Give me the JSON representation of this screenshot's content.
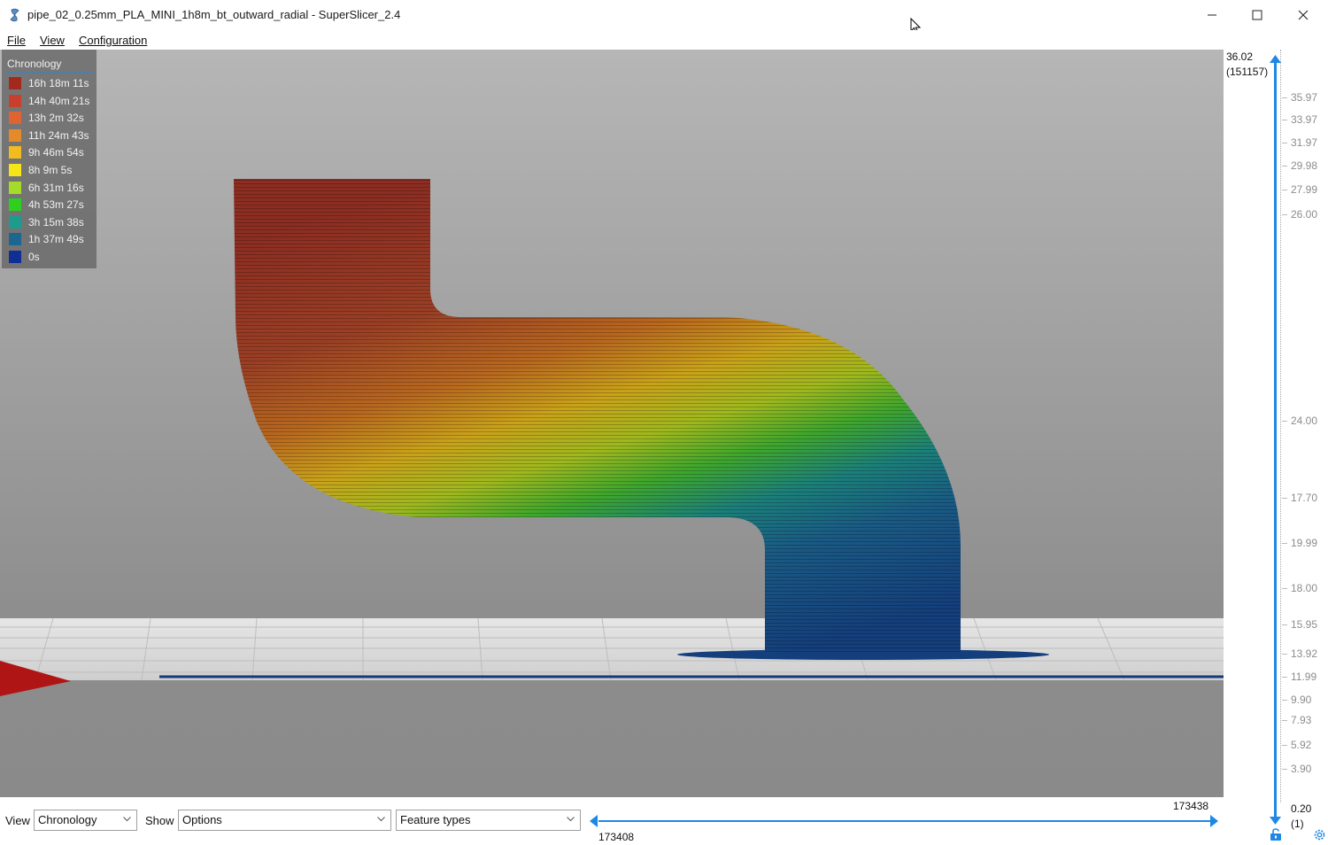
{
  "window": {
    "title": "pipe_02_0.25mm_PLA_MINI_1h8m_bt_outward_radial - SuperSlicer_2.4",
    "minimize_icon": "minimize-icon",
    "maximize_icon": "maximize-icon",
    "close_icon": "close-icon"
  },
  "menu": {
    "items": [
      {
        "label": "File",
        "mnemonic": "F"
      },
      {
        "label": "View",
        "mnemonic": "V"
      },
      {
        "label": "Configuration",
        "mnemonic": "C"
      }
    ]
  },
  "legend": {
    "title": "Chronology",
    "items": [
      {
        "label": "16h 18m 11s",
        "color": "#a3291f"
      },
      {
        "label": "14h 40m 21s",
        "color": "#c8402d"
      },
      {
        "label": "13h 2m 32s",
        "color": "#de6431"
      },
      {
        "label": "11h 24m 43s",
        "color": "#e58a2a"
      },
      {
        "label": "9h 46m 54s",
        "color": "#f0bc1f"
      },
      {
        "label": "8h 9m 5s",
        "color": "#f6e618"
      },
      {
        "label": "6h 31m 16s",
        "color": "#a5dc27"
      },
      {
        "label": "4h 53m 27s",
        "color": "#2ecf1e"
      },
      {
        "label": "3h 15m 38s",
        "color": "#1d9b8d"
      },
      {
        "label": "1h 37m 49s",
        "color": "#1b6792"
      },
      {
        "label": "0s",
        "color": "#0f2f94"
      }
    ]
  },
  "vertical_slider": {
    "top_value": "36.02",
    "top_layer": "(151157)",
    "ticks": [
      "35.97",
      "33.97",
      "31.97",
      "29.98",
      "27.99",
      "26.00",
      "24.00",
      "17.70",
      "19.99",
      "18.00",
      "15.95",
      "13.92",
      "11.99",
      "9.90",
      "7.93",
      "5.92",
      "3.90"
    ],
    "bottom_value": "0.20",
    "bottom_layer": "(1)",
    "lock_icon": "lock-icon",
    "settings_icon": "gear-icon"
  },
  "bottom_bar": {
    "view_label": "View",
    "view_value": "Chronology",
    "show_label": "Show",
    "options_value": "Options",
    "feature_value": "Feature types",
    "h_slider_top": "173438",
    "h_slider_bottom": "173408"
  }
}
